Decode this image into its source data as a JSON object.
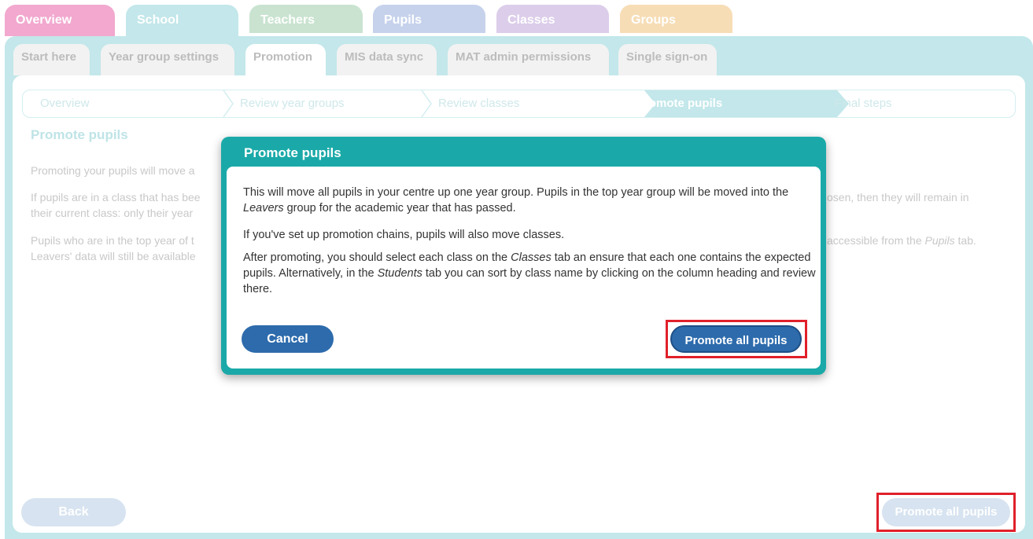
{
  "top_tabs": [
    {
      "label": "Overview",
      "color": "#f2a8cf"
    },
    {
      "label": "School",
      "color": "#c3e7ea"
    },
    {
      "label": "Teachers",
      "color": "#c9e3d0"
    },
    {
      "label": "Pupils",
      "color": "#c6d2ec"
    },
    {
      "label": "Classes",
      "color": "#dccdea"
    },
    {
      "label": "Groups",
      "color": "#f7ddb6"
    }
  ],
  "sub_tabs": [
    {
      "label": "Start here"
    },
    {
      "label": "Year group settings"
    },
    {
      "label": "Promotion"
    },
    {
      "label": "MIS data sync"
    },
    {
      "label": "MAT admin permissions"
    },
    {
      "label": "Single sign-on"
    }
  ],
  "steps": [
    {
      "label": "Overview"
    },
    {
      "label": "Review year groups"
    },
    {
      "label": "Review classes"
    },
    {
      "label": "Promote pupils"
    },
    {
      "label": "Final steps"
    }
  ],
  "page": {
    "title": "Promote pupils",
    "line1": "Promoting your pupils will move a",
    "line2a": "If pupils are in a class that has bee",
    "line2b": "their current class: only their year",
    "line2c": "osen, then they will remain in",
    "line3a": "Pupils who are in the top year of t",
    "line3b": "Leavers' data will still be available",
    "line3c_pre": "accessible from the ",
    "line3c_em": "Pupils",
    "line3c_post": " tab.",
    "back_label": "Back",
    "promote_label": "Promote all pupils"
  },
  "modal": {
    "title": "Promote pupils",
    "p1_pre": "This will move all pupils in your centre up one year group. Pupils in the top year group will be moved into the ",
    "p1_em": "Leavers",
    "p1_post": " group for the academic year that has passed.",
    "p2": "If you've set up promotion chains, pupils will also move classes.",
    "p3_pre": "After promoting, you should select each class on the ",
    "p3_em1": "Classes",
    "p3_mid": " tab an ensure that each one contains the expected pupils. Alternatively, in the ",
    "p3_em2": "Students",
    "p3_post": " tab you can sort by class name by clicking on the column heading and review there.",
    "cancel_label": "Cancel",
    "confirm_label": "Promote all pupils"
  }
}
